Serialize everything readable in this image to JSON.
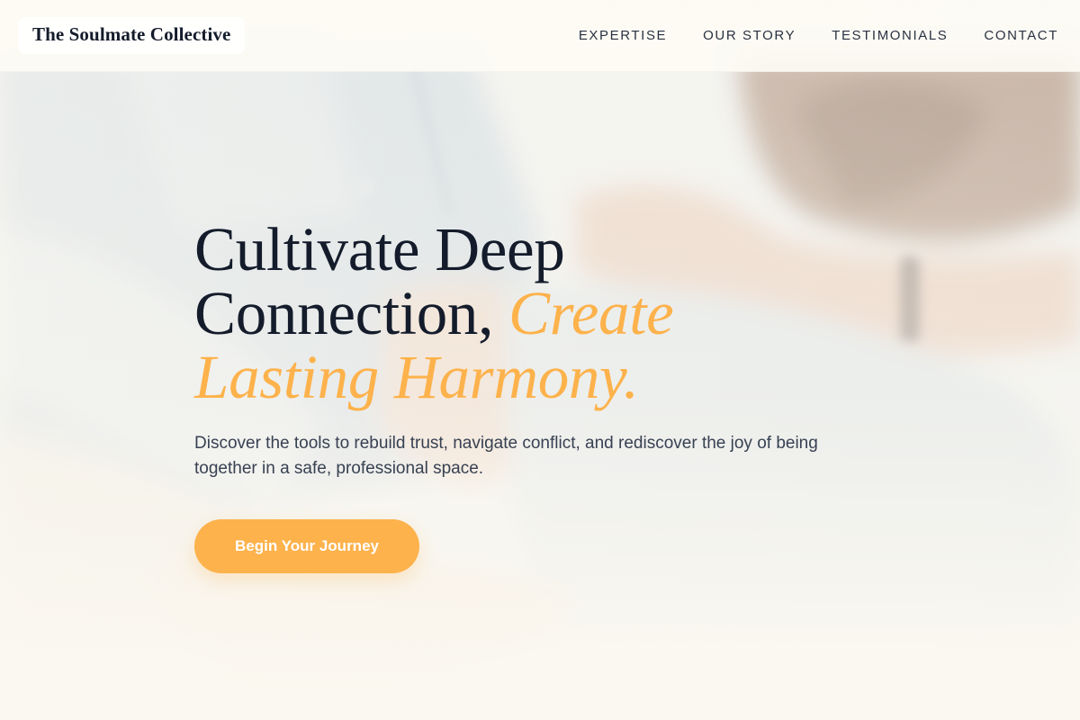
{
  "header": {
    "brand": "The Soulmate Collective",
    "nav": [
      {
        "label": "EXPERTISE"
      },
      {
        "label": "OUR STORY"
      },
      {
        "label": "TESTIMONIALS"
      },
      {
        "label": "CONTACT"
      }
    ]
  },
  "hero": {
    "title_line1": "Cultivate Deep",
    "title_line2": "Connection, ",
    "title_accent_1": "Create",
    "title_accent_2": "Lasting Harmony.",
    "subtitle": "Discover the tools to rebuild trust, navigate conflict, and rediscover the joy of being together in a safe, professional space.",
    "cta_label": "Begin Your Journey",
    "background_image": "couple-holding-hands-photo"
  },
  "colors": {
    "accent": "#fdb24c",
    "heading": "#141c2b",
    "body_text": "#384152",
    "background": "#fbf8f1"
  }
}
